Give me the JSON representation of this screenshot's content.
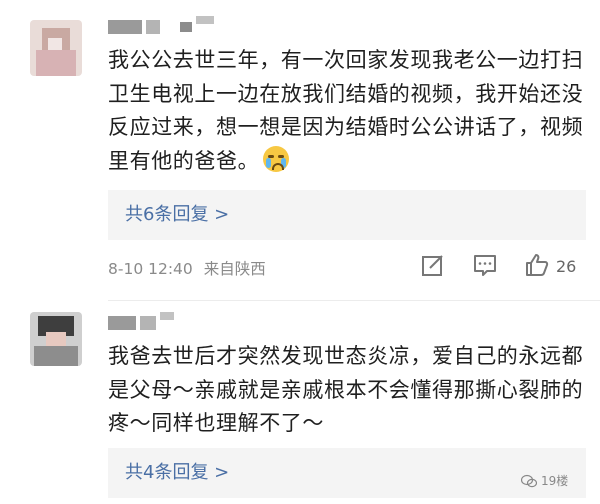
{
  "comments": [
    {
      "text": "我公公去世三年，有一次回家发现我老公一边打扫卫生电视上一边在放我们结婚的视频，我开始还没反应过来，想一想是因为结婚时公公讲话了，视频里有他的爸爸。",
      "emoji_icon": "crying-emoji-icon",
      "replies_label": "共6条回复 >",
      "timestamp": "8-10 12:40",
      "location": "来自陕西",
      "likes": "26"
    },
    {
      "text": "我爸去世后才突然发现世态炎凉，爱自己的永远都是父母～亲戚就是亲戚根本不会懂得那撕心裂肺的疼～同样也理解不了～",
      "replies_label": "共4条回复 >"
    }
  ],
  "watermark": {
    "icon": "wechat-icon",
    "text": "19楼"
  },
  "colors": {
    "reply_link": "#4a6fa5",
    "reply_bg": "#f4f4f4",
    "meta": "#8a8a8a",
    "emoji": "#f7c843"
  }
}
